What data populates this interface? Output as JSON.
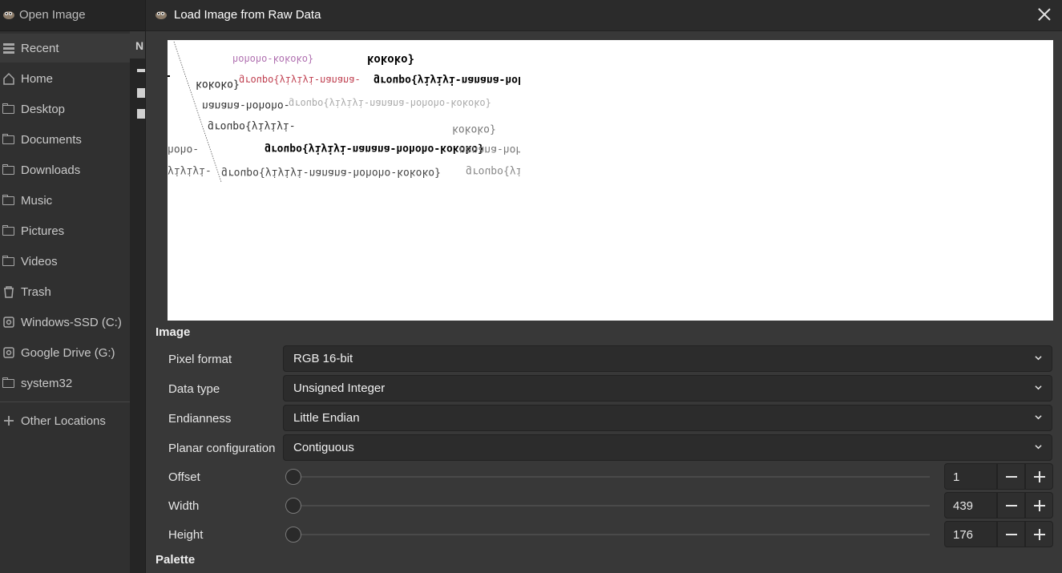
{
  "background_window": {
    "title": "Open Image",
    "column_header": "N",
    "places": [
      {
        "label": "Recent",
        "icon": "recent-icon",
        "active": true
      },
      {
        "label": "Home",
        "icon": "home-icon"
      },
      {
        "label": "Desktop",
        "icon": "folder-icon"
      },
      {
        "label": "Documents",
        "icon": "folder-icon"
      },
      {
        "label": "Downloads",
        "icon": "folder-icon"
      },
      {
        "label": "Music",
        "icon": "folder-icon"
      },
      {
        "label": "Pictures",
        "icon": "folder-icon"
      },
      {
        "label": "Videos",
        "icon": "folder-icon"
      },
      {
        "label": "Trash",
        "icon": "trash-icon"
      },
      {
        "label": "Windows-SSD (C:)",
        "icon": "drive-icon"
      },
      {
        "label": "Google Drive (G:)",
        "icon": "drive-icon"
      },
      {
        "label": "system32",
        "icon": "folder-icon"
      }
    ],
    "other_locations": "Other Locations"
  },
  "dialog": {
    "title": "Load Image from Raw Data",
    "preview_text": {
      "a": "kokoko}",
      "b": "groupo{yiyiyi-nanana-hohoho-",
      "c": "kokoko}",
      "d": "nanana-hohoho-",
      "e": "groupo{yiyiyi-nanana-hohoho-kokoko}",
      "f": "groupo{yiyiyi-",
      "g": "kokoko}",
      "h": "groupo{yiyiyi-nanana-hohoho-kokoko}",
      "i": "nanana-hoh",
      "j": "hoho-",
      "k": "yiyiyi-",
      "l": "groupo{yiyiyi-nanana-hohoho-kokoko}",
      "m": "groupo{yiy",
      "n": "groupo{yiyiyi-nanana-",
      "o": "hohoho-kokoko}"
    },
    "image_section": "Image",
    "pixel_format": {
      "label": "Pixel format",
      "value": "RGB 16-bit"
    },
    "data_type": {
      "label": "Data type",
      "value": "Unsigned Integer"
    },
    "endianness": {
      "label": "Endianness",
      "value": "Little Endian"
    },
    "planar": {
      "label": "Planar configuration",
      "value": "Contiguous"
    },
    "offset": {
      "label": "Offset",
      "value": "1"
    },
    "width": {
      "label": "Width",
      "value": "439"
    },
    "height": {
      "label": "Height",
      "value": "176"
    },
    "palette_section": "Palette"
  },
  "colors": {
    "dialog_bg": "#383838",
    "sidebar_bg": "#303030",
    "combo_bg": "#2c2c2c"
  }
}
